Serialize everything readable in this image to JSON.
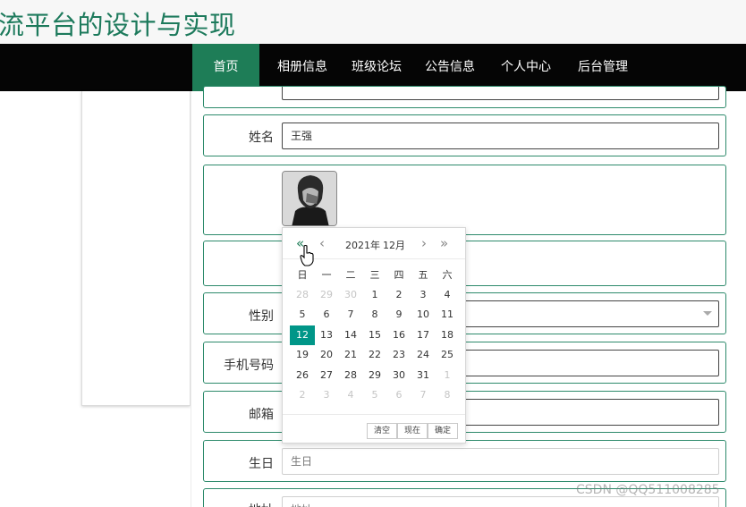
{
  "header": {
    "title": "流平台的设计与实现"
  },
  "nav": {
    "items": [
      {
        "label": "首页",
        "active": true
      },
      {
        "label": "相册信息"
      },
      {
        "label": "班级论坛"
      },
      {
        "label": "公告信息"
      },
      {
        "label": "个人中心"
      },
      {
        "label": "后台管理"
      }
    ]
  },
  "form": {
    "name_label": "姓名",
    "name_value": "王强",
    "gender_label": "性别",
    "phone_label": "手机号码",
    "email_label": "邮箱",
    "birthday_label": "生日",
    "birthday_placeholder": "生日",
    "next_label": "地址",
    "next_placeholder": "地址"
  },
  "calendar": {
    "year_label": "2021年",
    "month_label": "12月",
    "prev_year_icon": "«",
    "prev_month_icon": "‹",
    "next_month_icon": "›",
    "next_year_icon": "»",
    "weekdays": [
      "日",
      "一",
      "二",
      "三",
      "四",
      "五",
      "六"
    ],
    "weeks": [
      [
        "28",
        "29",
        "30",
        "1",
        "2",
        "3",
        "4"
      ],
      [
        "5",
        "6",
        "7",
        "8",
        "9",
        "10",
        "11"
      ],
      [
        "12",
        "13",
        "14",
        "15",
        "16",
        "17",
        "18"
      ],
      [
        "19",
        "20",
        "21",
        "22",
        "23",
        "24",
        "25"
      ],
      [
        "26",
        "27",
        "28",
        "29",
        "30",
        "31",
        "1"
      ],
      [
        "2",
        "3",
        "4",
        "5",
        "6",
        "7",
        "8"
      ]
    ],
    "selected": "12",
    "buttons": {
      "clear": "清空",
      "now": "现在",
      "confirm": "确定"
    }
  },
  "watermark": "CSDN @QQ511008285",
  "colors": {
    "brand_green": "#1e7d57",
    "title_green": "#1d7a5c",
    "row_border": "#2d8a6b",
    "selected_day": "#009688",
    "nav_bg": "#050505"
  }
}
